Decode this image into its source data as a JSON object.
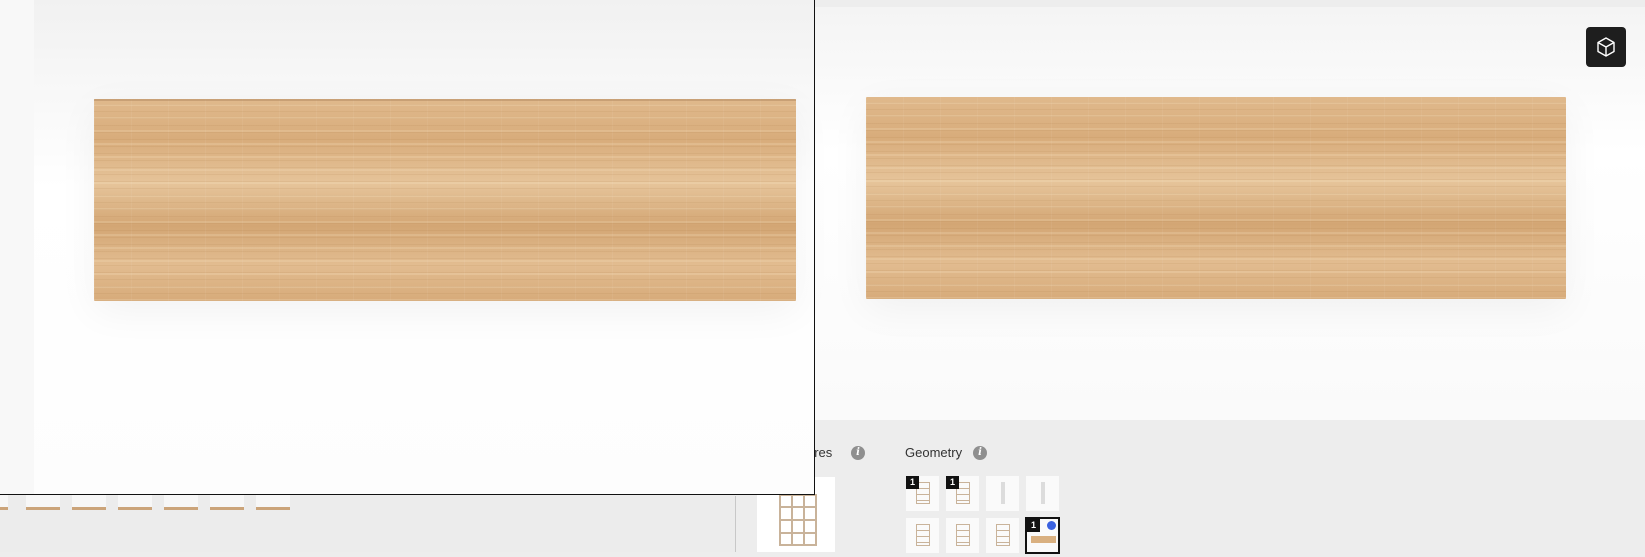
{
  "viewer": {
    "view_3d_icon": "cube-icon"
  },
  "configurator": {
    "textures_label": "ures",
    "geometry_label": "Geometry",
    "info_icon_glyph": "i",
    "geometry_options": [
      {
        "badge": "1",
        "kind": "shelf"
      },
      {
        "badge": "1",
        "kind": "shelf"
      },
      {
        "badge": "",
        "kind": "panel"
      },
      {
        "badge": "",
        "kind": "panel"
      },
      {
        "badge": "",
        "kind": "shelf"
      },
      {
        "badge": "",
        "kind": "shelf"
      },
      {
        "badge": "",
        "kind": "shelf"
      },
      {
        "badge": "1",
        "kind": "plank",
        "selected": true
      }
    ]
  },
  "colors": {
    "accent": "#3b62e0",
    "button_dark": "#1e1e1e",
    "wood": "#dcb384"
  }
}
